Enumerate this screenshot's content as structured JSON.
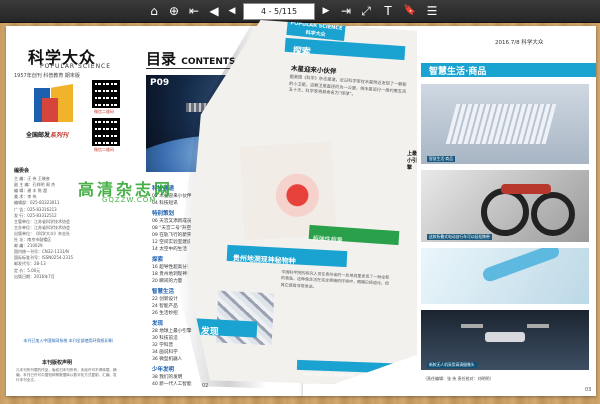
{
  "toolbar": {
    "page_indicator": "4 - 5/115",
    "icons": [
      "home-icon",
      "zoom-icon",
      "first-page-icon",
      "prev-page-icon",
      "next-page-icon",
      "last-page-icon",
      "fit-icon",
      "text-icon",
      "bookmark-icon",
      "menu-icon"
    ],
    "glyphs": {
      "home": "⌂",
      "zoom": "⊕",
      "first": "⇤",
      "prev": "◀",
      "next": "▶",
      "last": "⇥",
      "fit": "⤢",
      "text": "T",
      "bookmark": "🔖",
      "menu": "☰"
    }
  },
  "left_page": {
    "brand": "科学大众",
    "brand_sub": "POPULAR SCIENCE",
    "issue_line": "1957年创刊  科普教育  期末版",
    "logo_text_prefix": "全国邮发",
    "logo_text_suffix": "系列刊",
    "qr_labels": [
      "微信二维码",
      "微信二维码"
    ],
    "credits_heading": "编委会",
    "credits": [
      "主 编：汪 伟  王晓彦",
      "副 主 编：孔祥明 周 杰",
      "编 辑：谢 丰 陈 超",
      "美 术：李 伟",
      "编辑部：025-83323011",
      "广 告：025-83316213",
      "发 行：025-83312512",
      "主管单位：江苏省科学技术协会",
      "主办单位：江苏省科学技术协会",
      "出版单位：《科学大众》杂志社",
      "社 址：南京市鼓楼区",
      "邮 编：210029",
      "国内统一刊号：CN32-1131/N",
      "国际标准刊号：ISSN0254-2315",
      "邮发代号：28-13",
      "定 价：5.00元",
      "出版日期：2016年7月"
    ],
    "notice": "本刊已加入中国知网系统 本刊全部使用环保纸印刷",
    "law_heading": "本刊版权声明",
    "law_text": "凡本刊所刊载的作品，版权归本刊所有，未经许可不得转载、摘编。本刊已许可中国知网等数据库以数字化方式复制、汇编、发行本刊全文。",
    "toc_title": "目录",
    "toc_title_en": "CONTENTS",
    "hero_label": "P09",
    "page_number": "02",
    "watermark": "高清杂志网",
    "watermark_url": "GQZZW.COM",
    "toc": [
      {
        "section": "科技速递",
        "items": [
          "02 木星迎来小伙伴",
          "04 科技短讯"
        ]
      },
      {
        "section": "特别策划",
        "items": [
          "06 天宫又添新成员",
          "08 \"天宫二号\"升空",
          "09 在轨飞行的新突破",
          "12 空间实验室建设",
          "14 太空中的生活"
        ]
      },
      {
        "section": "探索",
        "items": [
          "16 超导性超高分子",
          "18 贵州地洞现神秘物种",
          "20 瞬间的力量"
        ]
      },
      {
        "section": "智慧生活",
        "items": [
          "22 创新设计",
          "24 智能产品",
          "26 生活妙招"
        ]
      },
      {
        "section": "发现",
        "items": [
          "28 地球上最小引擎",
          "30 科技前沿",
          "32 学科普",
          "34 画说科学",
          "36 微型机器人"
        ]
      },
      {
        "section": "少年发明",
        "items": [
          "38 我们的发明",
          "40 新一代人工智能"
        ]
      }
    ]
  },
  "curl_page": {
    "badge": "POPULAR SCIENCE 科学大众",
    "explore": "探索",
    "title": "木星迎来小伙伴",
    "body": "据美国《科学》杂志报道，近日科学家在木星附近发现了一颗新的小卫星，这颗卫星直径约为一公里，绕木星运行一周约需五百五十天，科学家将其命名为“怪球”。",
    "blue2": "贵州地洞现神秘物种",
    "body2": "中国科学院的研究人员在贵州省的一处地洞里发现了一种全新的盲鱼，这种鱼生活在完全黑暗的环境中，眼睛已经退化，但其它感官非常发达。",
    "discover": "发现",
    "green": "超弹性超量",
    "small": "上最小引擎",
    "footer": "www.kxdz.com  高清杂志网"
  },
  "right_page": {
    "date": "2016.7/8  科学大众",
    "section_title": "智慧生活·商品",
    "caption_1": "这款折叠式电动自行车可以轻松携带",
    "caption_2": "新款无人机采用高清摄像头",
    "foot_caption": "（责任编辑：张 伟  责任校对：刘明明）",
    "page_number": "03"
  }
}
